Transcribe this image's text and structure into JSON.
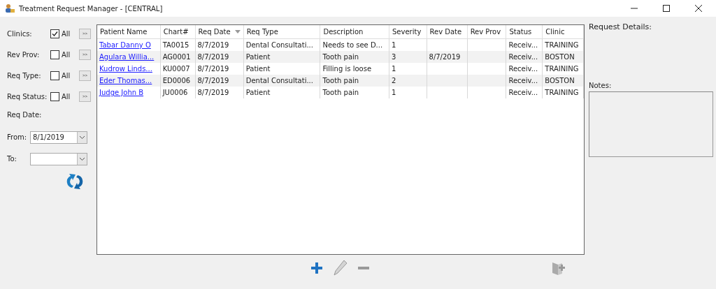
{
  "window": {
    "title": "Treatment Request Manager - [CENTRAL]"
  },
  "filters": [
    {
      "label": "Clinics:",
      "checkbox_label": "All",
      "checked": true,
      "button": ">>"
    },
    {
      "label": "Rev Prov:",
      "checkbox_label": "All",
      "checked": false,
      "button": ">>"
    },
    {
      "label": "Req Type:",
      "checkbox_label": "All",
      "checked": false,
      "button": ">>"
    },
    {
      "label": "Req Status:",
      "checkbox_label": "All",
      "checked": false,
      "button": ">>"
    }
  ],
  "req_date": {
    "label": "Req Date:",
    "from_label": "From:",
    "from_value": "8/1/2019",
    "to_label": "To:"
  },
  "table": {
    "columns": [
      {
        "label": "Patient Name",
        "sorted": false
      },
      {
        "label": "Chart#",
        "sorted": false
      },
      {
        "label": "Req Date",
        "sorted": true
      },
      {
        "label": "Req Type",
        "sorted": false
      },
      {
        "label": "Description",
        "sorted": false
      },
      {
        "label": "Severity",
        "sorted": false
      },
      {
        "label": "Rev Date",
        "sorted": false
      },
      {
        "label": "Rev Prov",
        "sorted": false
      },
      {
        "label": "Status",
        "sorted": false
      },
      {
        "label": "Clinic",
        "sorted": false
      }
    ],
    "rows": [
      [
        "Tabar Danny O",
        "TA0015",
        "8/7/2019",
        "Dental Consultati...",
        "Needs to see D...",
        "1",
        "",
        "",
        "Receiv...",
        "TRAINING"
      ],
      [
        "Agulara Willia...",
        "AG0001",
        "8/7/2019",
        "Patient",
        "Tooth pain",
        "3",
        "8/7/2019",
        "",
        "Receiv...",
        "BOSTON"
      ],
      [
        "Kudrow Linds...",
        "KU0007",
        "8/7/2019",
        "Patient",
        "Filling is loose",
        "1",
        "",
        "",
        "Receiv...",
        "TRAINING"
      ],
      [
        "Eder Thomas...",
        "ED0006",
        "8/7/2019",
        "Dental Consultati...",
        "Tooth pain",
        "2",
        "",
        "",
        "Receiv...",
        "BOSTON"
      ],
      [
        "Judge John B",
        "JU0006",
        "8/7/2019",
        "Patient",
        "Tooth pain",
        "1",
        "",
        "",
        "Receiv...",
        "TRAINING"
      ]
    ]
  },
  "details": {
    "title": "Request Details:",
    "notes_label": "Notes:"
  },
  "toolbar": [
    {
      "kind": "add",
      "disabled": false
    },
    {
      "kind": "edit",
      "disabled": true
    },
    {
      "kind": "remove",
      "disabled": true
    },
    {
      "kind": "attach",
      "disabled": true
    }
  ]
}
